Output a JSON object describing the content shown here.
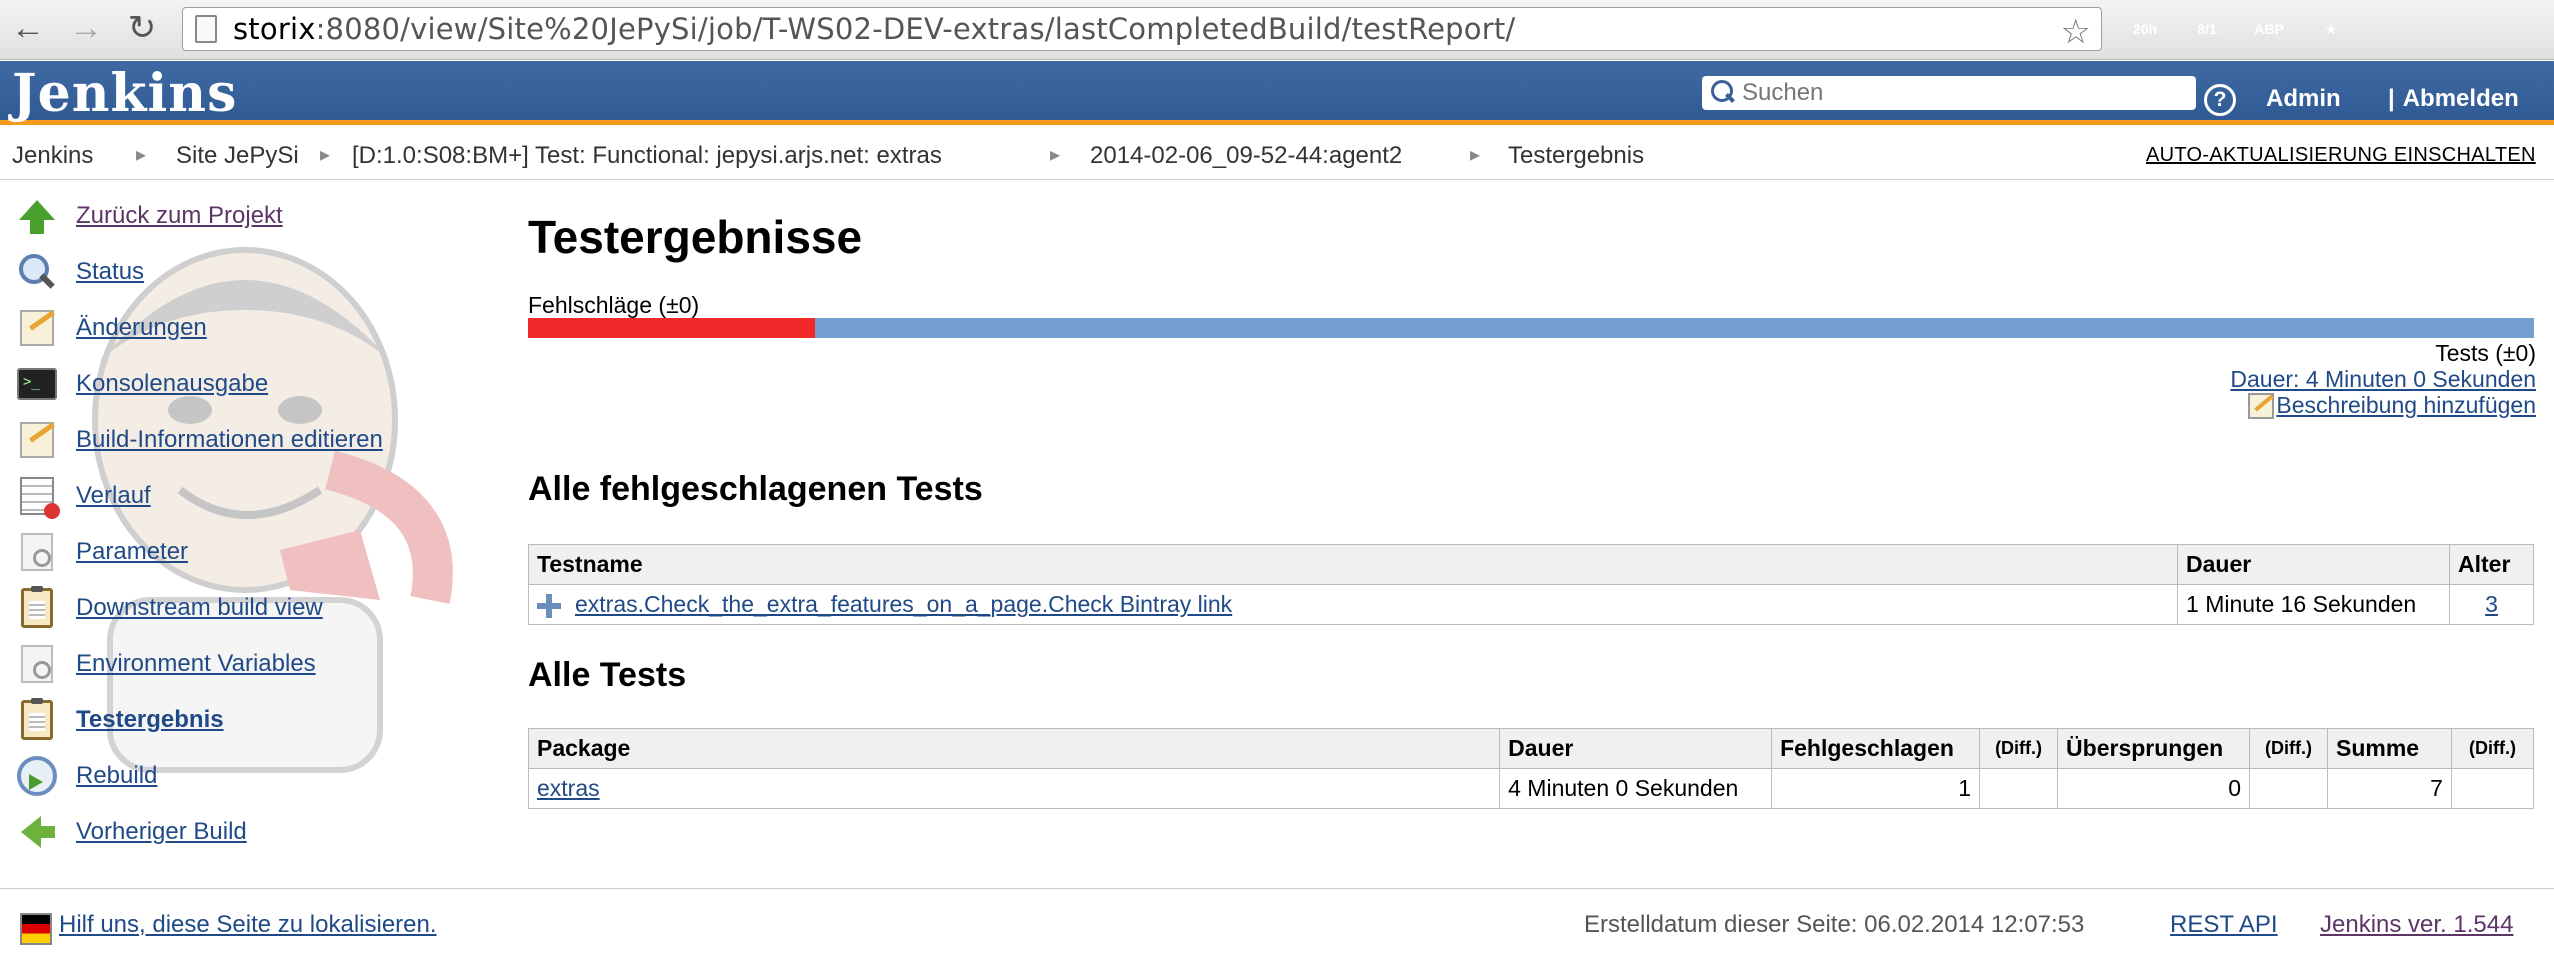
{
  "browser": {
    "url_host": "storix",
    "url_rest": ":8080/view/Site%20JePySi/job/T-WS02-DEV-extras/lastCompletedBuild/testReport/",
    "extensions": [
      {
        "name": "calendar-extension-icon",
        "label": "20h",
        "color": "#2d7ac9"
      },
      {
        "name": "calendar-extension-icon-2",
        "label": "8/1",
        "color": "#3a9b3a"
      },
      {
        "name": "adblock-plus-icon",
        "label": "ABP",
        "color": "#d0392b"
      },
      {
        "name": "bookmark-extension-icon",
        "label": "★",
        "color": "#c8352a"
      },
      {
        "name": "folder-extension-icon",
        "label": "",
        "color": "#5b8fd4"
      },
      {
        "name": "circle-extension-icon",
        "label": "",
        "color": "#888888"
      }
    ]
  },
  "header": {
    "logo": "Jenkins",
    "search_placeholder": "Suchen",
    "help": "?",
    "admin": "Admin",
    "logout_sep": "|",
    "logout": "Abmelden"
  },
  "breadcrumb": {
    "items": [
      "Jenkins",
      "Site JePySi",
      "[D:1.0:S08:BM+] Test: Functional: jepysi.arjs.net: extras",
      "2014-02-06_09-52-44:agent2",
      "Testergebnis"
    ],
    "separator": "▸",
    "autorefresh": "AUTO-AKTUALISIERUNG EINSCHALTEN"
  },
  "sidebar": {
    "items": [
      {
        "label": "Zurück zum Projekt",
        "icon": "arrow-up-icon"
      },
      {
        "label": "Status",
        "icon": "magnifier-icon"
      },
      {
        "label": "Änderungen",
        "icon": "notepad-icon"
      },
      {
        "label": "Konsolenausgabe",
        "icon": "terminal-icon"
      },
      {
        "label": "Build-Informationen editieren",
        "icon": "notepad-icon"
      },
      {
        "label": "Verlauf",
        "icon": "history-table-icon"
      },
      {
        "label": "Parameter",
        "icon": "document-gear-icon"
      },
      {
        "label": "Downstream build view",
        "icon": "clipboard-icon"
      },
      {
        "label": "Environment Variables",
        "icon": "document-gear-icon"
      },
      {
        "label": "Testergebnis",
        "icon": "clipboard-icon"
      },
      {
        "label": "Rebuild",
        "icon": "rebuild-icon"
      },
      {
        "label": "Vorheriger Build",
        "icon": "arrow-left-icon"
      }
    ]
  },
  "main": {
    "title": "Testergebnisse",
    "failures_label": "Fehlschläge (±0)",
    "fail_fraction": 0.143,
    "tests_label": "Tests (±0)",
    "duration_link": "Dauer: 4 Minuten 0 Sekunden",
    "add_description": "Beschreibung hinzufügen",
    "failed_section": {
      "heading": "Alle fehlgeschlagenen Tests",
      "columns": [
        "Testname",
        "Dauer",
        "Alter"
      ],
      "rows": [
        {
          "name": "extras.Check_the_extra_features_on_a_page.Check Bintray link",
          "duration": "1 Minute 16 Sekunden",
          "age": "3"
        }
      ]
    },
    "all_section": {
      "heading": "Alle Tests",
      "columns": [
        "Package",
        "Dauer",
        "Fehlgeschlagen",
        "(Diff.)",
        "Übersprungen",
        "(Diff.)",
        "Summe",
        "(Diff.)"
      ],
      "rows": [
        {
          "package": "extras",
          "duration": "4 Minuten 0 Sekunden",
          "failed": "1",
          "failed_diff": "",
          "skipped": "0",
          "skipped_diff": "",
          "total": "7",
          "total_diff": ""
        }
      ]
    }
  },
  "footer": {
    "localize": "Hilf uns, diese Seite zu lokalisieren.",
    "page_date": "Erstelldatum dieser Seite: 06.02.2014 12:07:53",
    "rest_api": "REST API",
    "version": "Jenkins ver. 1.544"
  }
}
